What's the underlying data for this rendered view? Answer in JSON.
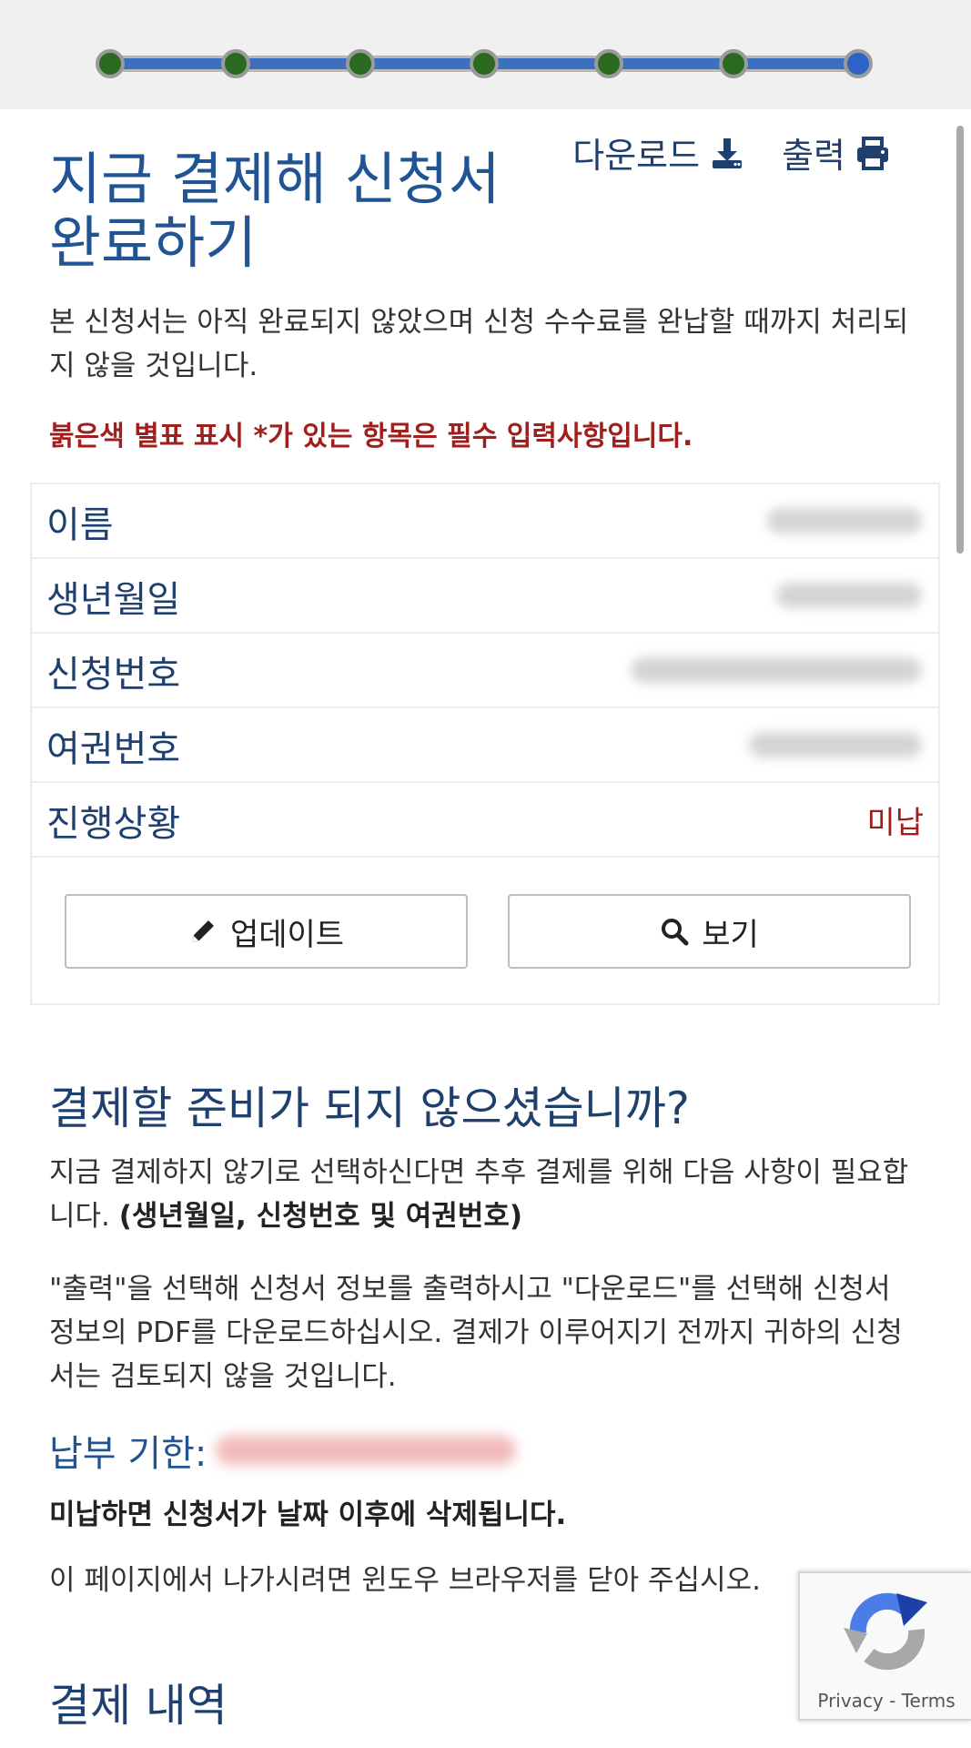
{
  "actions": {
    "download_label": "다운로드",
    "print_label": "출력"
  },
  "title": "지금 결제해 신청서 완료하기",
  "intro_text": "본 신청서는 아직 완료되지 않았으며 신청 수수료를 완납할 때까지 처리되지 않을 것입니다.",
  "required_note": "붉은색 별표 표시 *가 있는 항목은 필수 입력사항입니다.",
  "info": {
    "name_label": "이름",
    "dob_label": "생년월일",
    "application_no_label": "신청번호",
    "passport_no_label": "여권번호",
    "status_label": "진행상황",
    "status_value": "미납"
  },
  "buttons": {
    "update_label": "업데이트",
    "view_label": "보기"
  },
  "not_ready": {
    "title": "결제할 준비가 되지 않으셨습니까?",
    "para1": "지금 결제하지 않기로 선택하신다면 추후 결제를 위해 다음 사항이 필요합니다.",
    "para1_bold": "(생년월일, 신청번호 및 여권번호)",
    "para2": "\"출력\"을 선택해 신청서 정보를 출력하시고 \"다운로드\"를 선택해 신청서 정보의 PDF를 다운로드하십시오. 결제가 이루어지기 전까지 귀하의 신청서는 검토되지 않을 것입니다.",
    "due_label": "납부 기한:",
    "warning": "미납하면 신청서가 날짜 이후에 삭제됩니다.",
    "close_note": "이 페이지에서 나가시려면 윈도우 브라우저를 닫아 주십시오."
  },
  "payment_history_title": "결제 내역",
  "recaptcha": {
    "privacy": "Privacy",
    "separator": " - ",
    "terms": "Terms"
  },
  "colors": {
    "title_blue": "#205493",
    "dark_blue": "#1f3f6e",
    "required_red": "#a11e1e",
    "step_done": "#2a6a1e",
    "step_line": "#3d6fbf"
  }
}
